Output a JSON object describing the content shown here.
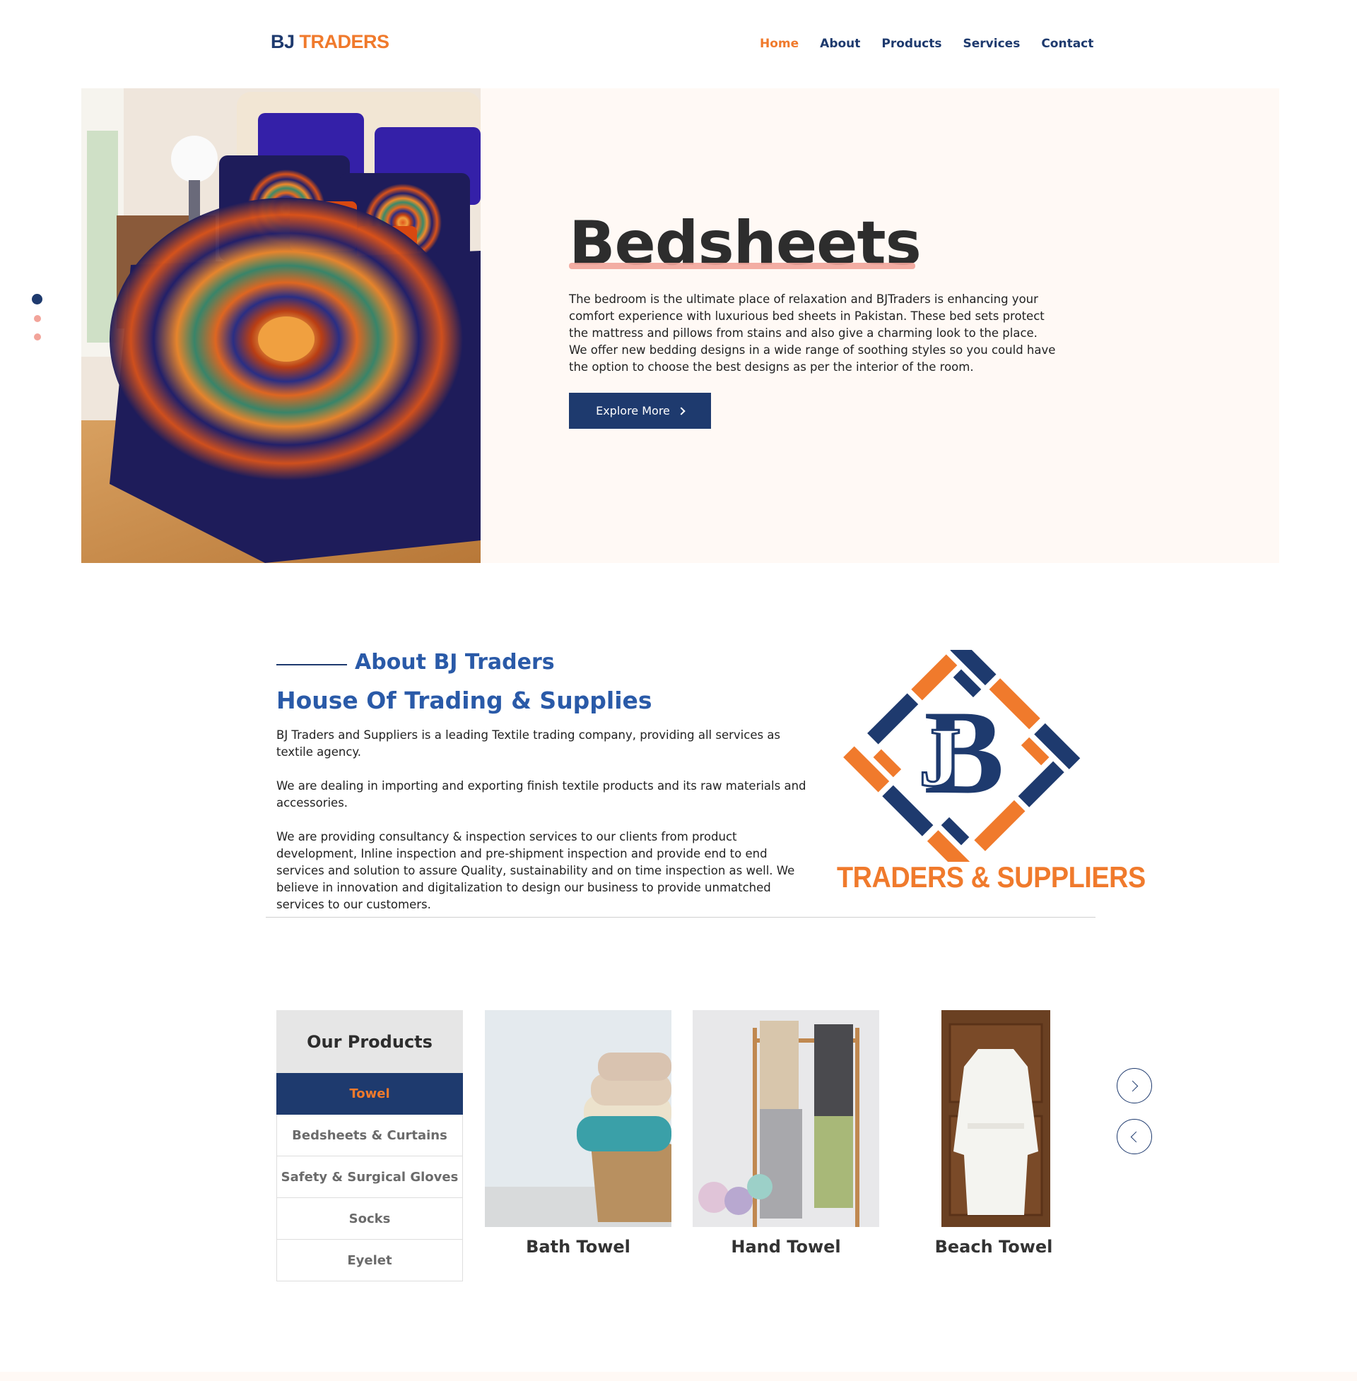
{
  "header": {
    "logo_bj": "BJ",
    "logo_traders": "TRADERS",
    "nav": [
      "Home",
      "About",
      "Products",
      "Services",
      "Contact"
    ],
    "active_nav": "Home"
  },
  "hero": {
    "title": "Bedsheets",
    "description": "The bedroom is the ultimate place of relaxation and BJTraders is enhancing your comfort experience with luxurious bed sheets in Pakistan. These bed sets protect the mattress and pillows from stains and also give a charming look to the place. We offer new bedding designs in a wide range of soothing styles so you could have the option to choose the best designs as per the interior of the room.",
    "button_label": "Explore More",
    "slide_count": 3,
    "active_slide": 1
  },
  "about": {
    "subtitle": "About BJ Traders",
    "title": "House Of Trading & Supplies",
    "paragraphs": [
      "BJ Traders and Suppliers is a leading Textile trading company, providing all services as textile agency.",
      "We are dealing in importing and exporting finish textile products and its raw materials and accessories.",
      "We are providing consultancy & inspection services to our clients from product development, Inline inspection and pre-shipment inspection and provide end to end services and solution to assure Quality, sustainability and on time inspection as well. We believe in innovation and digitalization to design our business to provide unmatched services to our customers."
    ],
    "logo_text": "TRADERS & SUPPLIERS"
  },
  "products": {
    "heading": "Our Products",
    "categories": [
      "Towel",
      "Bedsheets & Curtains",
      "Safety & Surgical Gloves",
      "Socks",
      "Eyelet"
    ],
    "active_category": "Towel",
    "items": [
      "Bath Towel",
      "Hand Towel",
      "Beach Towel"
    ]
  },
  "colors": {
    "navy": "#1e3a6e",
    "orange": "#f07a2c",
    "pink": "#f2a49a",
    "cream": "#fff9f5"
  }
}
